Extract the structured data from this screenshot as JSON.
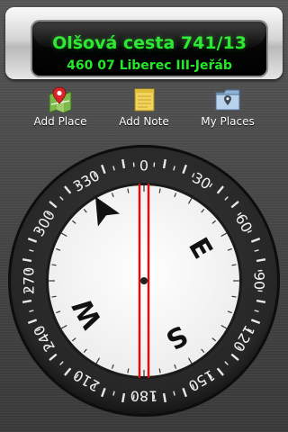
{
  "address": {
    "street": "Olšová cesta 741/13",
    "city": "460 07 Liberec III-Jeřáb"
  },
  "toolbar": {
    "add_place": {
      "label": "Add Place",
      "icon": "map-pin-icon"
    },
    "add_note": {
      "label": "Add Note",
      "icon": "note-icon"
    },
    "my_places": {
      "label": "My Places",
      "icon": "folder-pin-icon"
    }
  },
  "compass": {
    "heading_degrees": 0,
    "bezel_marks": [
      "0",
      "30",
      "60",
      "90",
      "120",
      "150",
      "180",
      "210",
      "240",
      "270",
      "300",
      "330"
    ],
    "cardinals": {
      "north_arrow": "N",
      "east": "E",
      "south": "S",
      "west": "W"
    },
    "cardinal_rotation_degrees": -30,
    "colors": {
      "bezel": "#2b2b2b",
      "dial": "#ffffff",
      "needle_lines": "#d21313",
      "address_text": "#23e82a"
    }
  }
}
